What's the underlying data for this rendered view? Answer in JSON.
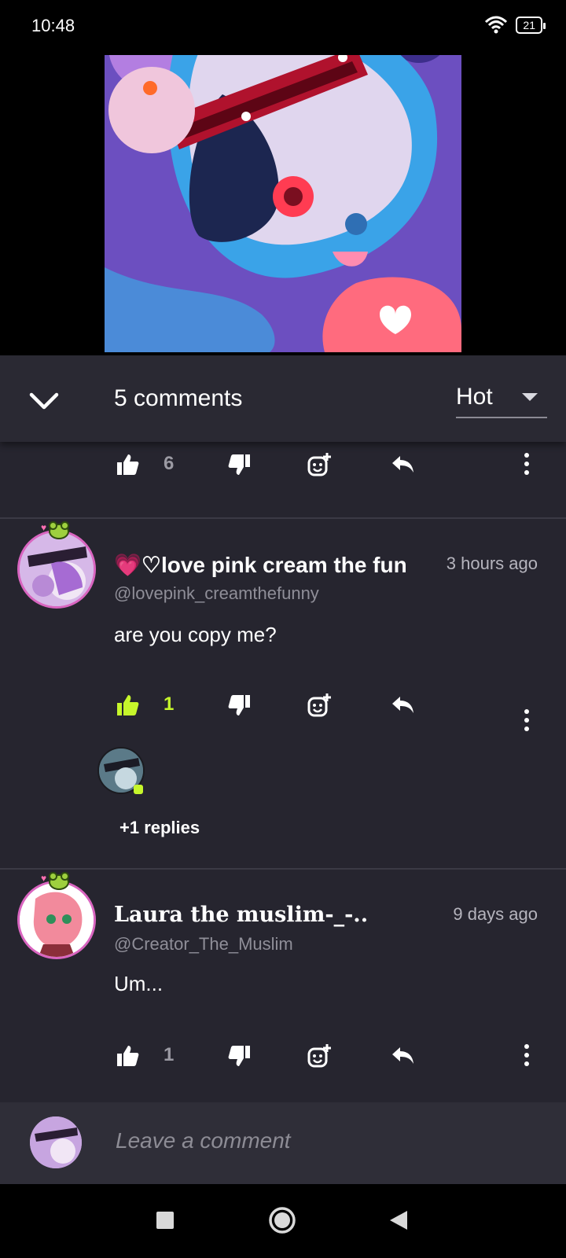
{
  "status_bar": {
    "time": "10:48",
    "battery": "21",
    "icons": [
      "wifi-icon",
      "battery-icon"
    ]
  },
  "media": {
    "alt": "artwork"
  },
  "header": {
    "comments_count": "5 comments",
    "sort_value": "Hot",
    "icons": [
      "chevron-down-icon",
      "caret-down-icon"
    ]
  },
  "top_actions": {
    "likes": "6"
  },
  "comments": [
    {
      "name": "💗♡love pink cream the fun",
      "handle": "@lovepink_creamthefunny",
      "time": "3 hours ago",
      "text": "are you copy me?",
      "likes": "1",
      "liked": true,
      "replies_label": "+1 replies"
    },
    {
      "name": "Laura the muslim-_-..",
      "handle": "@Creator_The_Muslim",
      "time": "9 days ago",
      "text": "Um...",
      "likes": "1",
      "liked": false
    }
  ],
  "composer": {
    "placeholder": "Leave a comment"
  },
  "colors": {
    "background": "#26252f",
    "header": "#2a2933",
    "accent_green": "#c6f62b",
    "muted": "#8f8e98",
    "avatar_ring": "#d965c0"
  },
  "action_icons": [
    "thumbs-up-icon",
    "thumbs-down-icon",
    "add-emoji-icon",
    "reply-icon",
    "more-icon"
  ],
  "nav_icons": [
    "recents-square-icon",
    "home-circle-icon",
    "back-triangle-icon"
  ]
}
